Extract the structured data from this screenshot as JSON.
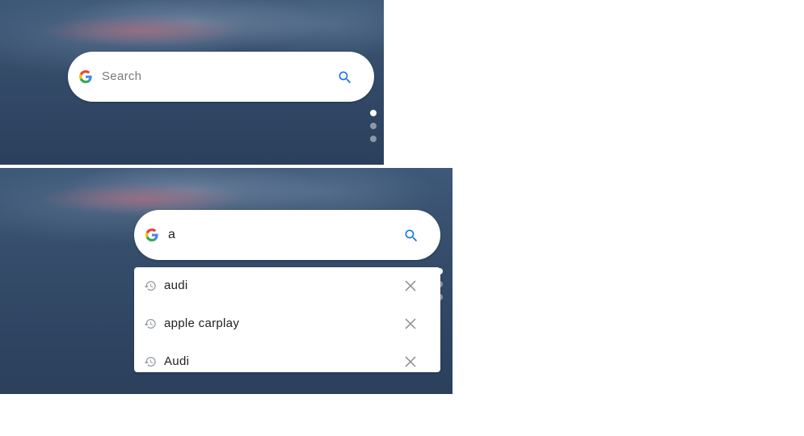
{
  "top_widget": {
    "search": {
      "placeholder": "Search"
    },
    "page_indicator": {
      "count": 3,
      "active_index": 0
    }
  },
  "bottom_widget": {
    "search": {
      "value": "a"
    },
    "suggestions": [
      {
        "label": "audi",
        "icon": "history-icon",
        "action_icon": "close-icon"
      },
      {
        "label": "apple carplay",
        "icon": "history-icon",
        "action_icon": "close-icon"
      },
      {
        "label": "Audi",
        "icon": "history-icon",
        "action_icon": "close-icon"
      }
    ]
  },
  "colors": {
    "google_blue": "#4285F4",
    "google_red": "#EA4335",
    "google_yellow": "#FBBC05",
    "google_green": "#34A853",
    "search_icon_blue": "#1A73E8",
    "wallpaper": "#354d6a"
  }
}
